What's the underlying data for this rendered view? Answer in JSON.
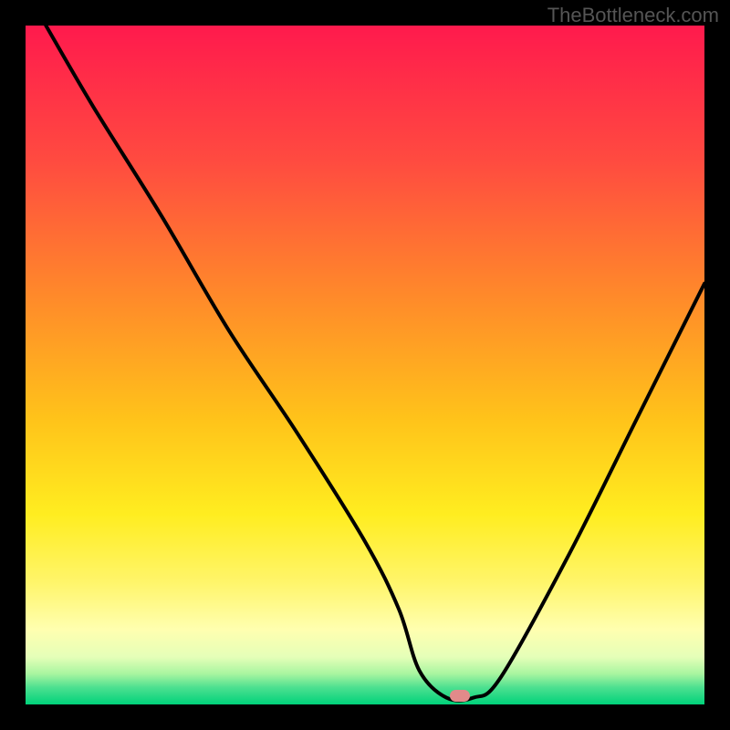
{
  "watermark": "TheBottleneck.com",
  "chart_data": {
    "type": "line",
    "title": "",
    "xlabel": "",
    "ylabel": "",
    "xlim": [
      0,
      100
    ],
    "ylim": [
      0,
      100
    ],
    "grid": false,
    "legend": false,
    "series": [
      {
        "name": "bottleneck-curve",
        "x": [
          3,
          10,
          20,
          30,
          40,
          50,
          55,
          58,
          62,
          66,
          70,
          80,
          90,
          100
        ],
        "y": [
          100,
          88,
          72,
          55,
          40,
          24,
          14,
          5,
          1,
          1,
          4,
          22,
          42,
          62
        ]
      }
    ],
    "marker": {
      "x": 64,
      "y": 1
    },
    "background_gradient": {
      "stops": [
        {
          "pos": 0.0,
          "color": "#ff1a4d"
        },
        {
          "pos": 0.2,
          "color": "#ff4b40"
        },
        {
          "pos": 0.4,
          "color": "#ff8a2a"
        },
        {
          "pos": 0.58,
          "color": "#ffc31a"
        },
        {
          "pos": 0.72,
          "color": "#ffed20"
        },
        {
          "pos": 0.82,
          "color": "#fff56a"
        },
        {
          "pos": 0.89,
          "color": "#ffffb0"
        },
        {
          "pos": 0.93,
          "color": "#e5ffb8"
        },
        {
          "pos": 0.955,
          "color": "#a8f5a0"
        },
        {
          "pos": 0.975,
          "color": "#4de090"
        },
        {
          "pos": 1.0,
          "color": "#00d27a"
        }
      ]
    }
  }
}
